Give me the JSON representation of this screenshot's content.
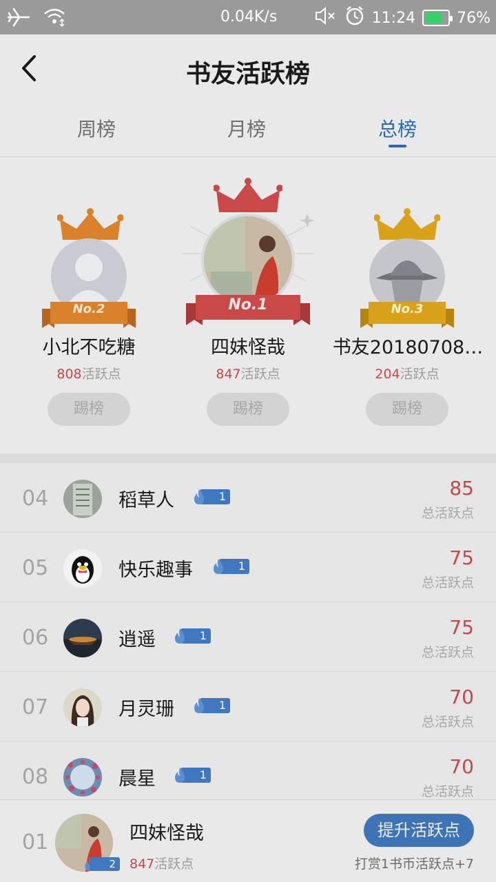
{
  "status_bar": {
    "speed": "0.04K/s",
    "time": "11:24",
    "battery": "76%",
    "battery_level": 0.76,
    "icons": [
      "airplane-icon",
      "wifi-icon",
      "mute-icon",
      "alarm-icon"
    ]
  },
  "header": {
    "title": "书友活跃榜"
  },
  "tabs": [
    {
      "label": "周榜",
      "active": false
    },
    {
      "label": "月榜",
      "active": false
    },
    {
      "label": "总榜",
      "active": true
    }
  ],
  "podium": [
    {
      "badge": "No.2",
      "name": "小北不吃糖",
      "points": "808",
      "points_suffix": "活跃点",
      "button": "踢榜"
    },
    {
      "badge": "No.1",
      "name": "四妹怪哉",
      "points": "847",
      "points_suffix": "活跃点",
      "button": "踢榜"
    },
    {
      "badge": "No.3",
      "name": "书友20180708…",
      "points": "204",
      "points_suffix": "活跃点",
      "button": "踢榜"
    }
  ],
  "list": [
    {
      "rank": "04",
      "name": "稻草人",
      "level": "1",
      "score": "85",
      "label": "总活跃点"
    },
    {
      "rank": "05",
      "name": "快乐趣事",
      "level": "1",
      "score": "75",
      "label": "总活跃点"
    },
    {
      "rank": "06",
      "name": "逍遥",
      "level": "1",
      "score": "75",
      "label": "总活跃点"
    },
    {
      "rank": "07",
      "name": "月灵珊",
      "level": "1",
      "score": "70",
      "label": "总活跃点"
    },
    {
      "rank": "08",
      "name": "晨星",
      "level": "1",
      "score": "70",
      "label": "总活跃点"
    }
  ],
  "me": {
    "rank": "01",
    "name": "四妹怪哉",
    "level": "2",
    "points": "847",
    "points_suffix": "活跃点",
    "cta": "提升活跃点",
    "tip": "打赏1书币活跃点+7"
  },
  "colors": {
    "accent": "#2a6ab3",
    "score_red": "#c24a4a",
    "gold": "#d9a21b",
    "bronze_orange": "#d9822b",
    "crimson": "#c94848"
  }
}
